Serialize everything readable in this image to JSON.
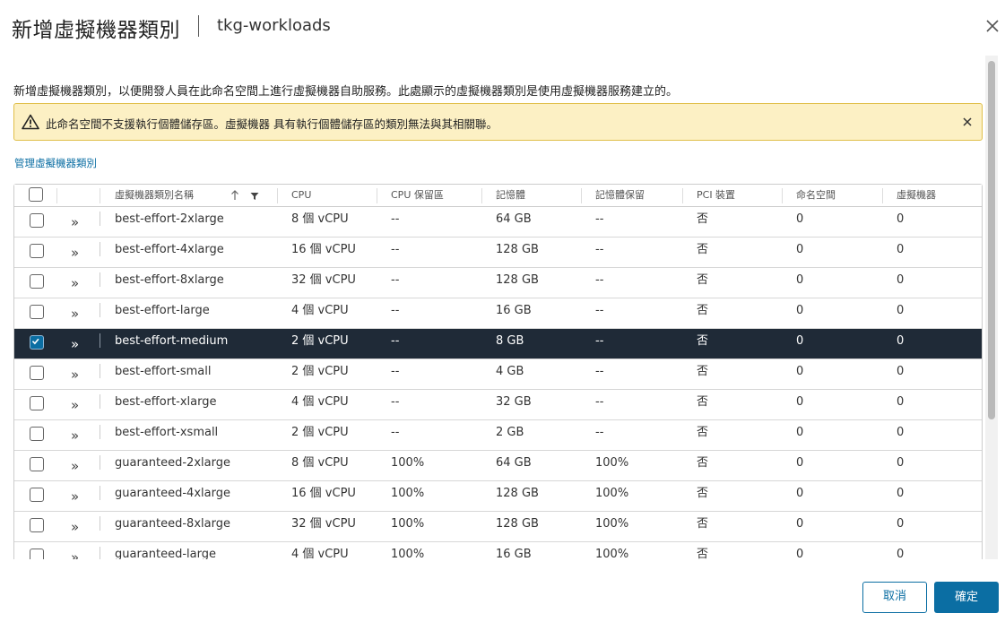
{
  "dialog": {
    "title": "新增虛擬機器類別",
    "subtitle": "tkg-workloads",
    "description": "新增虛擬機器類別，以便開發人員在此命名空間上進行虛擬機器自助服務。此處顯示的虛擬機器類別是使用虛擬機器服務建立的。",
    "alert_text": "此命名空間不支援執行個體儲存區。虛擬機器 具有執行個體儲存區的類別無法與其相關聯。",
    "manage_link": "管理虛擬機器類別"
  },
  "table": {
    "columns": [
      "虛擬機器類別名稱",
      "CPU",
      "CPU 保留區",
      "記憶體",
      "記憶體保留",
      "PCI 裝置",
      "命名空間",
      "虛擬機器"
    ],
    "rows": [
      {
        "name": "best-effort-2xlarge",
        "cpu": "8 個 vCPU",
        "cpu_res": "--",
        "mem": "64 GB",
        "mem_res": "--",
        "pci": "否",
        "ns": "0",
        "vm": "0",
        "selected": false
      },
      {
        "name": "best-effort-4xlarge",
        "cpu": "16 個 vCPU",
        "cpu_res": "--",
        "mem": "128 GB",
        "mem_res": "--",
        "pci": "否",
        "ns": "0",
        "vm": "0",
        "selected": false
      },
      {
        "name": "best-effort-8xlarge",
        "cpu": "32 個 vCPU",
        "cpu_res": "--",
        "mem": "128 GB",
        "mem_res": "--",
        "pci": "否",
        "ns": "0",
        "vm": "0",
        "selected": false
      },
      {
        "name": "best-effort-large",
        "cpu": "4 個 vCPU",
        "cpu_res": "--",
        "mem": "16 GB",
        "mem_res": "--",
        "pci": "否",
        "ns": "0",
        "vm": "0",
        "selected": false
      },
      {
        "name": "best-effort-medium",
        "cpu": "2 個 vCPU",
        "cpu_res": "--",
        "mem": "8 GB",
        "mem_res": "--",
        "pci": "否",
        "ns": "0",
        "vm": "0",
        "selected": true
      },
      {
        "name": "best-effort-small",
        "cpu": "2 個 vCPU",
        "cpu_res": "--",
        "mem": "4 GB",
        "mem_res": "--",
        "pci": "否",
        "ns": "0",
        "vm": "0",
        "selected": false
      },
      {
        "name": "best-effort-xlarge",
        "cpu": "4 個 vCPU",
        "cpu_res": "--",
        "mem": "32 GB",
        "mem_res": "--",
        "pci": "否",
        "ns": "0",
        "vm": "0",
        "selected": false
      },
      {
        "name": "best-effort-xsmall",
        "cpu": "2 個 vCPU",
        "cpu_res": "--",
        "mem": "2 GB",
        "mem_res": "--",
        "pci": "否",
        "ns": "0",
        "vm": "0",
        "selected": false
      },
      {
        "name": "guaranteed-2xlarge",
        "cpu": "8 個 vCPU",
        "cpu_res": "100%",
        "mem": "64 GB",
        "mem_res": "100%",
        "pci": "否",
        "ns": "0",
        "vm": "0",
        "selected": false
      },
      {
        "name": "guaranteed-4xlarge",
        "cpu": "16 個 vCPU",
        "cpu_res": "100%",
        "mem": "128 GB",
        "mem_res": "100%",
        "pci": "否",
        "ns": "0",
        "vm": "0",
        "selected": false
      },
      {
        "name": "guaranteed-8xlarge",
        "cpu": "32 個 vCPU",
        "cpu_res": "100%",
        "mem": "128 GB",
        "mem_res": "100%",
        "pci": "否",
        "ns": "0",
        "vm": "0",
        "selected": false
      },
      {
        "name": "guaranteed-large",
        "cpu": "4 個 vCPU",
        "cpu_res": "100%",
        "mem": "16 GB",
        "mem_res": "100%",
        "pci": "否",
        "ns": "0",
        "vm": "0",
        "selected": false
      }
    ]
  },
  "footer": {
    "cancel_label": "取消",
    "ok_label": "確定"
  },
  "colors": {
    "accent": "#0b6ea3",
    "selected_row": "#1f2a37",
    "alert_bg": "#fcf0c4"
  }
}
